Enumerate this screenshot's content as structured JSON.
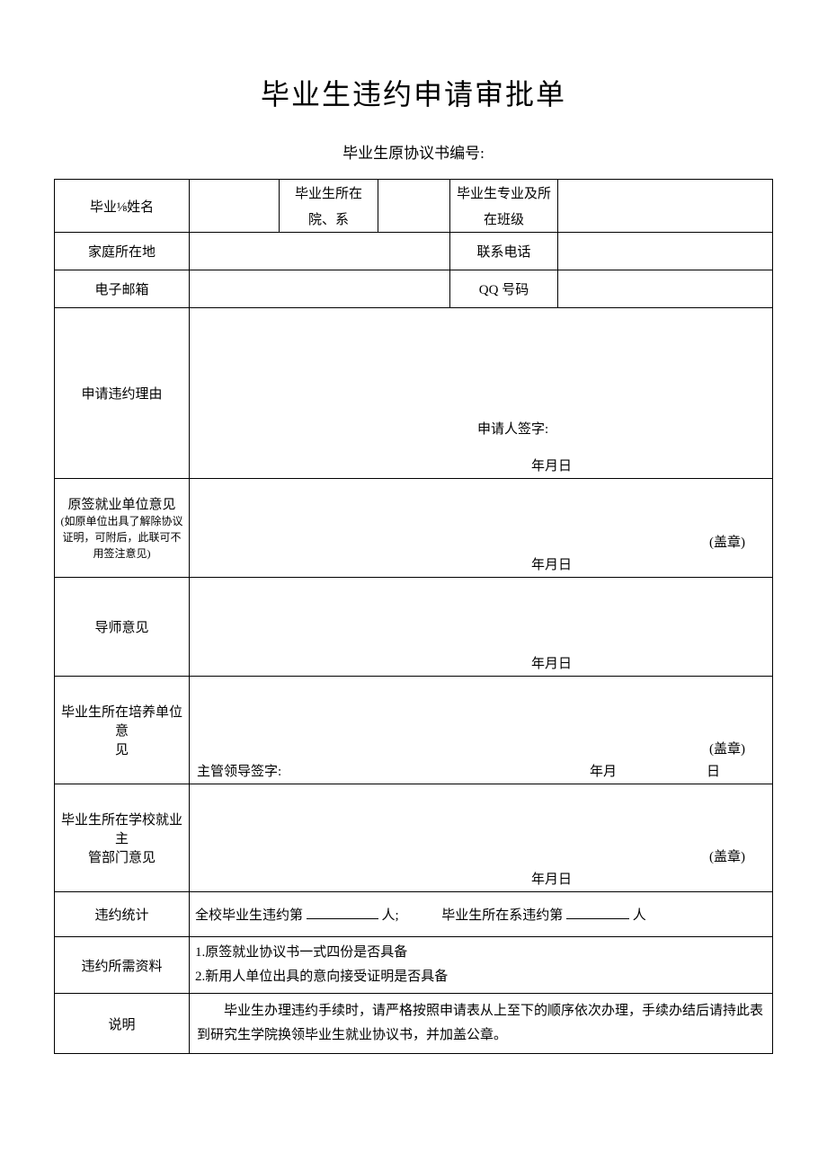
{
  "title": "毕业生违约申请审批单",
  "subtitle": "毕业生原协议书编号:",
  "row1": {
    "name_label": "毕业⅛姓名",
    "dept_label_l1": "毕业生所在",
    "dept_label_l2": "院、系",
    "major_label_l1": "毕业生专业及所",
    "major_label_l2": "在班级"
  },
  "row2": {
    "home_label": "家庭所在地",
    "phone_label": "联系电话"
  },
  "row3": {
    "email_label": "电子邮箱",
    "qq_label": "QQ 号码"
  },
  "reason": {
    "label": "申请违约理由",
    "sign": "申请人签字:",
    "date": "年月日"
  },
  "orig_employer": {
    "label_l1": "原签就业单位意见",
    "label_note": "(如原单位出具了解除协议证明，可附后，此联可不用签注意见)",
    "seal": "(盖章)",
    "date": "年月日"
  },
  "advisor": {
    "label": "导师意见",
    "date": "年月日"
  },
  "cultivate_unit": {
    "label_l1": "毕业生所在培养单位意",
    "label_l2": "见",
    "seal": "(盖章)",
    "sign": "主管领导签字:",
    "date_ym": "年月",
    "date_d": "日"
  },
  "school_dept": {
    "label_l1": "毕业生所在学校就业主",
    "label_l2": "管部门意见",
    "seal": "(盖章)",
    "date": "年月日"
  },
  "stats": {
    "label": "违约统计",
    "text1": "全校毕业生违约第",
    "text2": "人;",
    "text3": "毕业生所在系违约第",
    "text4": "人"
  },
  "materials": {
    "label": "违约所需资料",
    "item1": "1.原签就业协议书一式四份是否具备",
    "item2": "2.新用人单位出具的意向接受证明是否具备"
  },
  "description": {
    "label": "说明",
    "text": "毕业生办理违约手续时，请严格按照申请表从上至下的顺序依次办理，手续办结后请持此表到研究生学院换领毕业生就业协议书，并加盖公章。"
  }
}
